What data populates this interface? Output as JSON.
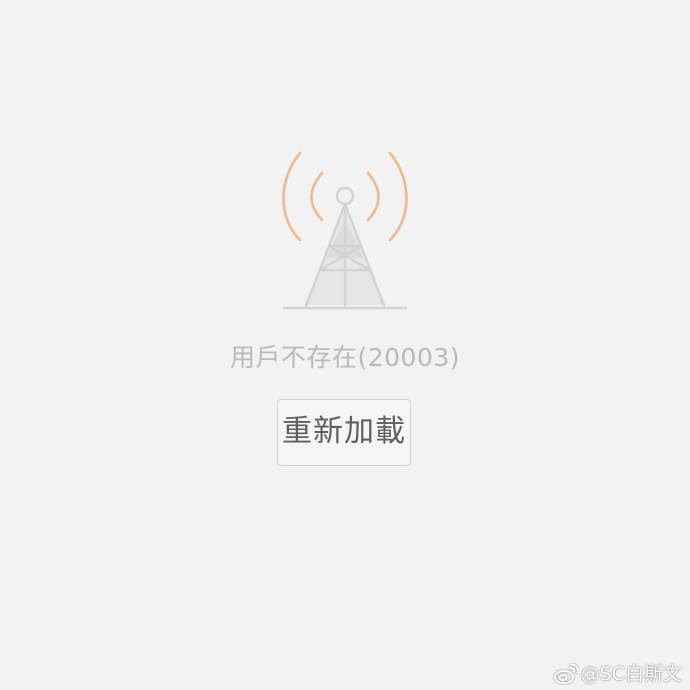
{
  "error": {
    "message": "用戶不存在(20003)"
  },
  "reload_button": {
    "label": "重新加載"
  },
  "watermark": {
    "handle": "@SC白斯文",
    "icon": "weibo-logo"
  },
  "icons": {
    "signal_tower": "signal-tower-icon"
  },
  "colors": {
    "background": "#f2f2f2",
    "signal_waves": "#f0b98c",
    "tower": "#d6d6d6",
    "error_text": "#b9b9b9",
    "button_text": "#5f5f5f",
    "button_border": "#d2d2d2"
  }
}
